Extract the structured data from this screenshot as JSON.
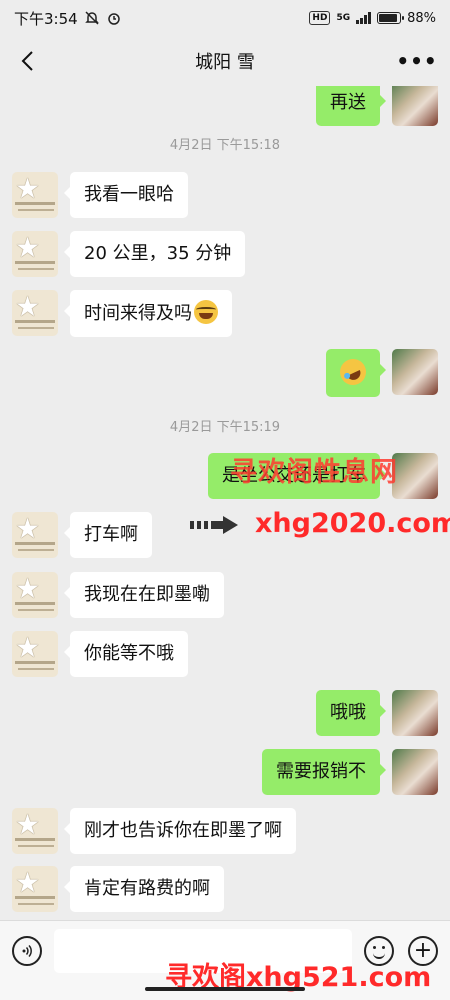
{
  "status_bar": {
    "time": "下午3:54",
    "network": "5G",
    "hd": "HD",
    "battery_percent": "88%",
    "battery_level": 0.88
  },
  "header": {
    "title": "城阳 雪",
    "back_icon": "chevron-left-icon",
    "more_icon": "more-dots-icon"
  },
  "messages": [
    {
      "dir": "out",
      "text": "再送"
    },
    {
      "type": "time",
      "text": "4月2日 下午15:18"
    },
    {
      "dir": "in",
      "text": "我看一眼哈"
    },
    {
      "dir": "in",
      "text": "20 公里，35 分钟"
    },
    {
      "dir": "in",
      "text": "时间来得及吗"
    },
    {
      "dir": "out",
      "emoji": "laughing-tears-emoji"
    },
    {
      "type": "time",
      "text": "4月2日 下午15:19"
    },
    {
      "dir": "out",
      "text": "是坐公交还是打车"
    },
    {
      "dir": "in",
      "text": "打车啊"
    },
    {
      "dir": "in",
      "text": "我现在在即墨嘞"
    },
    {
      "dir": "in",
      "text": "你能等不哦"
    },
    {
      "dir": "out",
      "text": "哦哦"
    },
    {
      "dir": "out",
      "text": "需要报销不"
    },
    {
      "dir": "in",
      "text": "刚才也告诉你在即墨了啊"
    },
    {
      "dir": "in",
      "text": "肯定有路费的啊"
    }
  ],
  "watermarks": {
    "line1": "寻欢阁性息网",
    "line2": "xhg2020.com",
    "line3": "寻欢阁xhg521.com"
  },
  "input_bar": {
    "placeholder": "",
    "voice_icon": "voice-icon",
    "emoji_icon": "smile-icon",
    "add_icon": "plus-icon"
  }
}
